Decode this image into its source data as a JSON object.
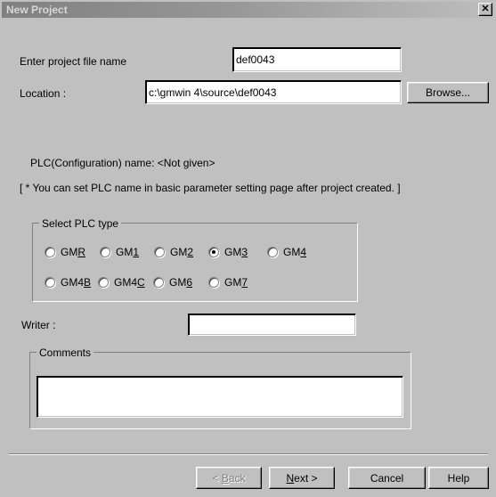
{
  "window": {
    "title": "New Project",
    "close_label": "✕",
    "close_icon": "close-icon"
  },
  "form": {
    "file_name_label": "Enter project file name",
    "file_name_value": "def0043",
    "file_name_placeholder": "",
    "location_label": "Location :",
    "location_value": "c:\\gmwin 4\\source\\def0043",
    "location_placeholder": "",
    "browse_label": "Browse...",
    "writer_label": "Writer :",
    "writer_value": "",
    "writer_placeholder": ""
  },
  "plc_info": {
    "config_name_line": "PLC(Configuration) name:  <Not given>",
    "hint_line": "[ * You can set PLC name in basic parameter setting page after project created. ]"
  },
  "plc_group": {
    "title": "Select PLC type",
    "options": [
      {
        "id": "gmr",
        "prefix": "GM",
        "accel": "R",
        "suffix": "",
        "checked": false
      },
      {
        "id": "gm1",
        "prefix": "GM",
        "accel": "1",
        "suffix": "",
        "checked": false
      },
      {
        "id": "gm2",
        "prefix": "GM",
        "accel": "2",
        "suffix": "",
        "checked": false
      },
      {
        "id": "gm3",
        "prefix": "GM",
        "accel": "3",
        "suffix": "",
        "checked": true
      },
      {
        "id": "gm4",
        "prefix": "GM",
        "accel": "4",
        "suffix": "",
        "checked": false
      },
      {
        "id": "gm4b",
        "prefix": "GM4",
        "accel": "B",
        "suffix": "",
        "checked": false
      },
      {
        "id": "gm4c",
        "prefix": "GM4",
        "accel": "C",
        "suffix": "",
        "checked": false
      },
      {
        "id": "gm6",
        "prefix": "GM",
        "accel": "6",
        "suffix": "",
        "checked": false
      },
      {
        "id": "gm7",
        "prefix": "GM",
        "accel": "7",
        "suffix": "",
        "checked": false
      }
    ]
  },
  "comments_group": {
    "title": "Comments",
    "value": "",
    "placeholder": ""
  },
  "footer": {
    "buttons": [
      {
        "id": "back",
        "text_before": "< ",
        "accel": "B",
        "text_after": "ack",
        "disabled": true
      },
      {
        "id": "next",
        "text_before": "",
        "accel": "N",
        "text_after": "ext >",
        "disabled": false
      },
      {
        "id": "cancel",
        "text_before": "Cancel",
        "accel": "",
        "text_after": "",
        "disabled": false
      },
      {
        "id": "help",
        "text_before": "Help",
        "accel": "",
        "text_after": "",
        "disabled": false
      }
    ]
  },
  "colors": {
    "dialog_face": "#c0c0c0",
    "field_bg": "#ffffff",
    "title_text": "#d8d8d8",
    "disabled_text": "#808080",
    "text": "#000000"
  }
}
